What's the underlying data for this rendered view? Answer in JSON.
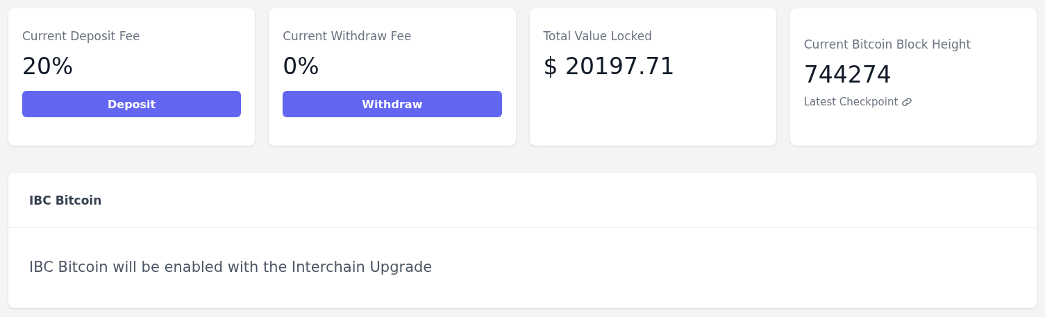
{
  "stats": [
    {
      "kind": "action",
      "label": "Current Deposit Fee",
      "value": "20%",
      "button": "Deposit"
    },
    {
      "kind": "action",
      "label": "Current Withdraw Fee",
      "value": "0%",
      "button": "Withdraw"
    },
    {
      "kind": "plain",
      "label": "Total Value Locked",
      "value": "$ 20197.71"
    },
    {
      "kind": "link",
      "label": "Current Bitcoin Block Height",
      "value": "744274",
      "link": "Latest Checkpoint"
    }
  ],
  "panel": {
    "title": "IBC Bitcoin",
    "message": "IBC Bitcoin will be enabled with the Interchain Upgrade"
  }
}
